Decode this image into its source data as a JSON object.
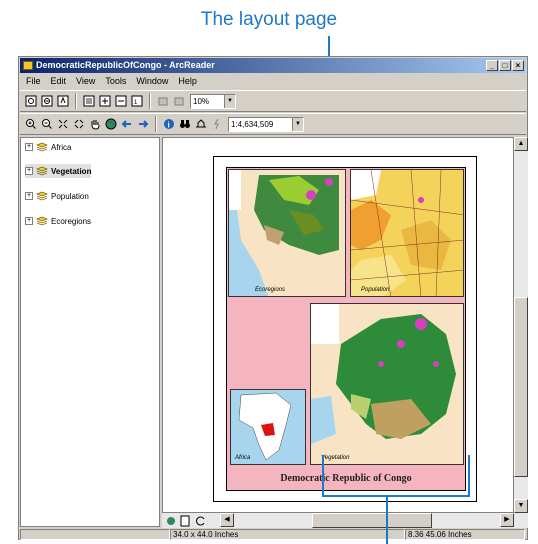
{
  "callout": {
    "text": "The layout page",
    "color": "#1f78c8"
  },
  "window": {
    "title": "DemocraticRepublicOfCongo - ArcReader",
    "buttons": [
      "_",
      "□",
      "×"
    ]
  },
  "menu": [
    "File",
    "Edit",
    "View",
    "Tools",
    "Window",
    "Help"
  ],
  "toolbar1": {
    "zoom_value": "10%"
  },
  "toolbar2": {
    "scale_value": "1:4,634,509"
  },
  "toc": {
    "layers": [
      {
        "label": "Africa",
        "bold": false
      },
      {
        "label": "Vegetation",
        "bold": true
      },
      {
        "label": "Population",
        "bold": false
      },
      {
        "label": "Ecoregions",
        "bold": false
      }
    ]
  },
  "layout": {
    "title": "Democratic Republic of Congo",
    "map_labels": [
      "Ecoregions",
      "Population",
      "Vegetation",
      "Africa"
    ]
  },
  "status": {
    "page_size": "34.0 x 44.0 Inches",
    "coords": "8.36  45.06 Inches"
  }
}
